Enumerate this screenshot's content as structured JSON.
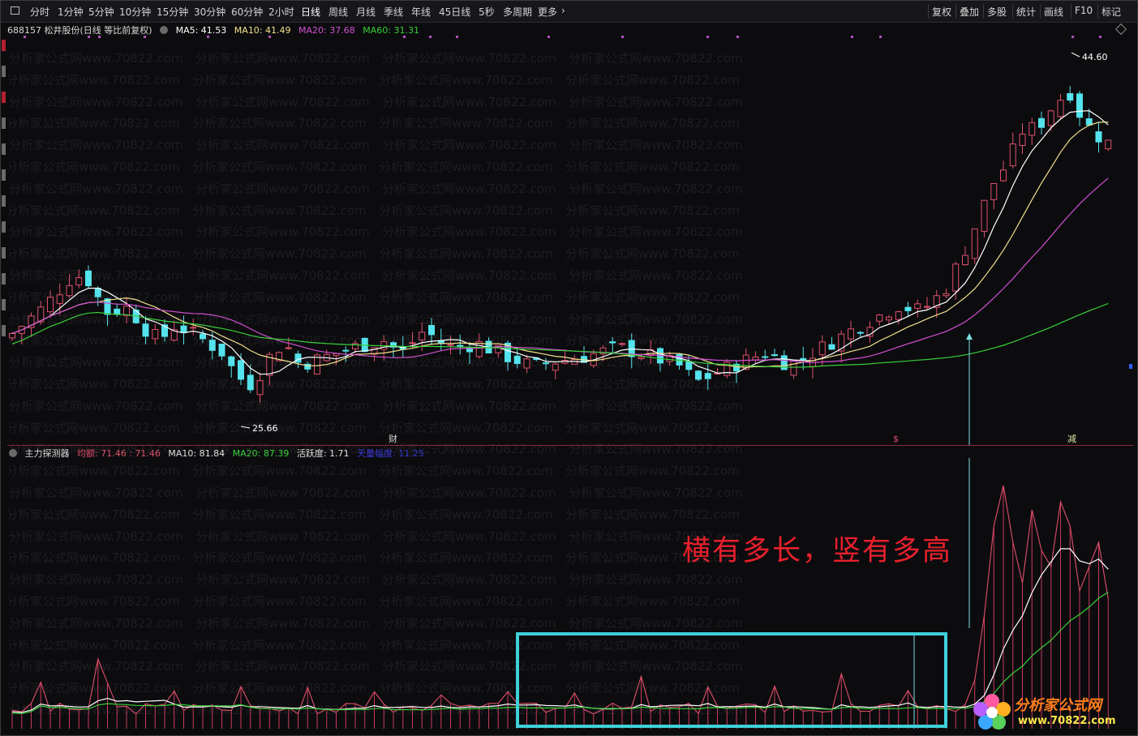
{
  "toolbar": {
    "left_items": [
      "分时",
      "1分钟",
      "5分钟",
      "10分钟",
      "15分钟",
      "30分钟",
      "60分钟",
      "2小时",
      "日线",
      "周线",
      "月线",
      "季线",
      "年线",
      "45日线",
      "5秒",
      "多周期",
      "更多"
    ],
    "active": "日线",
    "right_items": [
      "复权",
      "叠加",
      "多股",
      "统计",
      "画线",
      "F10",
      "标记"
    ]
  },
  "stock": {
    "title": "688157 松井股份(日线 等比前复权)",
    "ma5_label": "MA5: 41.53",
    "ma10_label": "MA10: 41.49",
    "ma20_label": "MA20: 37.68",
    "ma60_label": "MA60: 31.31"
  },
  "main_chart": {
    "high_label": "44.60",
    "low_label": "25.66",
    "markers": [
      "财",
      "$",
      "减"
    ]
  },
  "indicator": {
    "name": "主力探测器",
    "avg_label": "均额: 71.46 : 71.46",
    "ma10_label": "MA10: 81.84",
    "ma20_label": "MA20: 87.39",
    "activity_label": "活跃度: 1.71",
    "extra_label": "天量幅度: 11.25"
  },
  "slogan": "横有多长，竖有多高",
  "watermark": "分析家公式网www.70822.com",
  "logo": {
    "name": "分析家公式网",
    "url": "www.70822.com"
  },
  "colors": {
    "up": "#e0506a",
    "down": "#54e3ec",
    "ma5": "#ffffff",
    "ma10": "#f2e08a",
    "ma20": "#d14fd1",
    "ma60": "#38d038",
    "highlight": "#3fd0d8",
    "slogan": "#e8202c"
  }
}
